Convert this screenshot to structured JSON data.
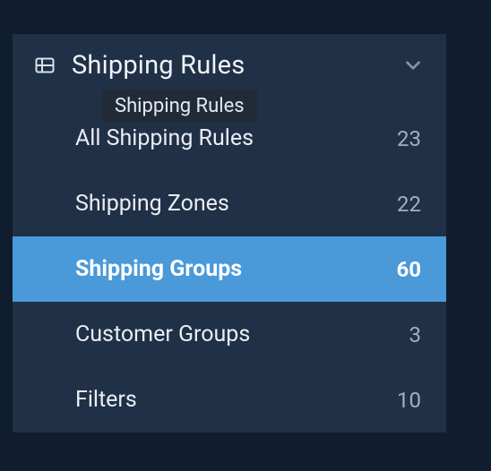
{
  "section": {
    "title": "Shipping Rules",
    "tooltip": "Shipping Rules"
  },
  "items": [
    {
      "label": "All Shipping Rules",
      "count": "23",
      "active": false
    },
    {
      "label": "Shipping Zones",
      "count": "22",
      "active": false
    },
    {
      "label": "Shipping Groups",
      "count": "60",
      "active": true
    },
    {
      "label": "Customer Groups",
      "count": "3",
      "active": false
    },
    {
      "label": "Filters",
      "count": "10",
      "active": false
    }
  ]
}
